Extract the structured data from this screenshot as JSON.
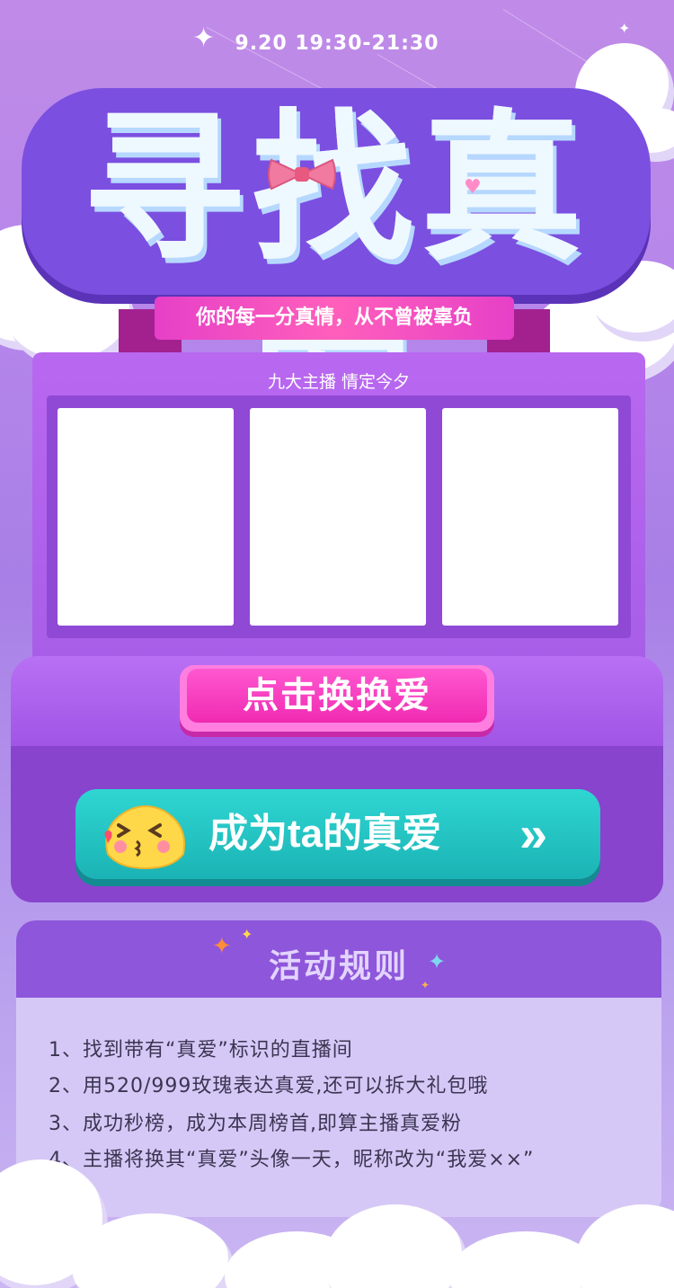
{
  "header": {
    "date_time": "9.20  19:30-21:30",
    "title": "寻找真爱",
    "subtitle": "你的每一分真情，从不曾被辜负"
  },
  "machine": {
    "caption": "九大主播 情定今夕",
    "cards": [
      "",
      "",
      ""
    ],
    "swap_button_label": "点击换换爱"
  },
  "cta": {
    "label": "成为ta的真爱",
    "arrow_icon": "double-chevron-right-icon",
    "emoji_icon": "kissing-face-icon"
  },
  "rules": {
    "title": "活动规则",
    "items": [
      "1、找到带有“真爱”标识的直播间",
      "2、用520/999玫瑰表达真爱,还可以拆大礼包哦",
      "3、成功秒榜，成为本周榜首,即算主播真爱粉",
      "4、主播将换其“真爱”头像一天，昵称改为“我爱××”"
    ]
  },
  "colors": {
    "accent_pink": "#f02ab2",
    "accent_teal": "#1bb3b5",
    "machine_purple": "#a85ee8"
  }
}
